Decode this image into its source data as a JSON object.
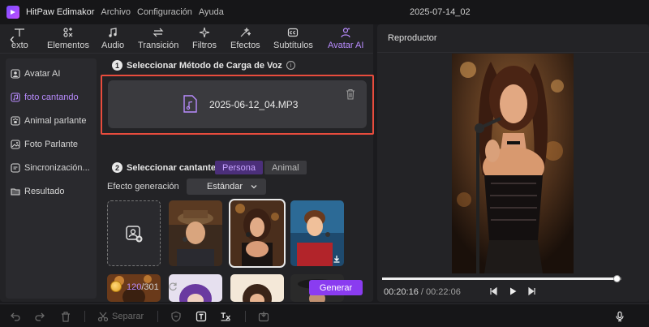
{
  "titlebar": {
    "app_name": "HitPaw Edimakor",
    "menus": [
      "Archivo",
      "Configuración",
      "Ayuda"
    ],
    "document_title": "2025-07-14_02"
  },
  "tabs": [
    {
      "label": "exto",
      "icon": "text-icon"
    },
    {
      "label": "Elementos",
      "icon": "elements-icon"
    },
    {
      "label": "Audio",
      "icon": "music-icon"
    },
    {
      "label": "Transición",
      "icon": "transition-icon"
    },
    {
      "label": "Filtros",
      "icon": "sparkle-icon"
    },
    {
      "label": "Efectos",
      "icon": "effects-icon"
    },
    {
      "label": "Subtítulos",
      "icon": "subtitles-icon"
    },
    {
      "label": "Avatar AI",
      "icon": "avatar-icon",
      "active": true
    }
  ],
  "sidebar": {
    "items": [
      {
        "label": "Avatar AI",
        "icon": "avatar-icon"
      },
      {
        "label": "foto cantando",
        "icon": "music-note-icon",
        "active": true
      },
      {
        "label": "Animal parlante",
        "icon": "paw-icon"
      },
      {
        "label": "Foto Parlante",
        "icon": "image-icon"
      },
      {
        "label": "Sincronización...",
        "icon": "sync-icon"
      },
      {
        "label": "Resultado",
        "icon": "folder-icon"
      }
    ]
  },
  "step1": {
    "number": "1",
    "title": "Seleccionar Método de Carga de Voz",
    "file_name": "2025-06-12_04.MP3"
  },
  "step2": {
    "number": "2",
    "title": "Seleccionar cantante",
    "options": [
      "Persona",
      "Animal"
    ],
    "selected_option": "Persona"
  },
  "effect": {
    "label": "Efecto generación",
    "value": "Estándar"
  },
  "credits": {
    "used": "120",
    "total": "/301"
  },
  "generate_label": "Generar",
  "player": {
    "title": "Reproductor",
    "current_time": "00:20:16",
    "separator": " / ",
    "total_time": "00:22:06",
    "progress": 0.98
  },
  "toolbar": {
    "separate_label": "Separar"
  },
  "colors": {
    "accent": "#8a3cf0",
    "accent_text": "#b98cff",
    "highlight_outline": "#e84c3d"
  }
}
